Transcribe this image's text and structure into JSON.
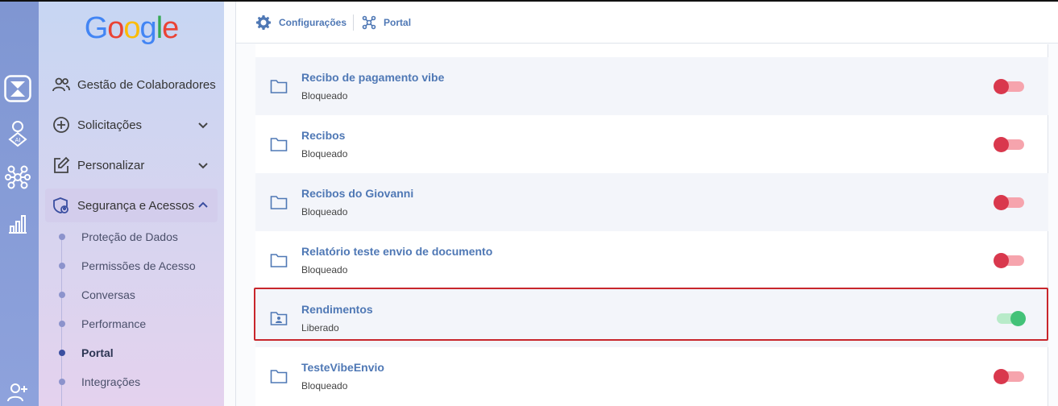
{
  "sidebar": {
    "logo_letters": [
      {
        "char": "G",
        "color": "#4285F4"
      },
      {
        "char": "o",
        "color": "#EA4335"
      },
      {
        "char": "o",
        "color": "#FBBC05"
      },
      {
        "char": "g",
        "color": "#4285F4"
      },
      {
        "char": "l",
        "color": "#34A853"
      },
      {
        "char": "e",
        "color": "#EA4335"
      }
    ],
    "menu": [
      {
        "label": "Gestão de Colaboradores",
        "icon": "people-icon"
      },
      {
        "label": "Solicitações",
        "icon": "plus-circle-icon",
        "chevron": "down"
      },
      {
        "label": "Personalizar",
        "icon": "edit-icon",
        "chevron": "down"
      },
      {
        "label": "Segurança e Acessos",
        "icon": "shield-user-icon",
        "chevron": "up",
        "active": true
      }
    ],
    "submenu": [
      {
        "label": "Proteção de Dados"
      },
      {
        "label": "Permissões de Acesso"
      },
      {
        "label": "Conversas"
      },
      {
        "label": "Performance"
      },
      {
        "label": "Portal",
        "current": true
      },
      {
        "label": "Integrações"
      }
    ]
  },
  "rail": {
    "icons": [
      "hourglass-app-icon",
      "ai-user-icon",
      "network-icon",
      "bar-chart-icon",
      "add-user-icon"
    ]
  },
  "header": {
    "breadcrumb": [
      {
        "label": "Configurações",
        "icon": "gear-icon"
      },
      {
        "label": "Portal",
        "icon": "nodes-icon"
      }
    ]
  },
  "folders": [
    {
      "title": "Recibo de pagamento vibe",
      "status": "Bloqueado",
      "enabled": false
    },
    {
      "title": "Recibos",
      "status": "Bloqueado",
      "enabled": false
    },
    {
      "title": "Recibos do Giovanni",
      "status": "Bloqueado",
      "enabled": false
    },
    {
      "title": "Relatório teste envio de documento",
      "status": "Bloqueado",
      "enabled": false
    },
    {
      "title": "Rendimentos",
      "status": "Liberado",
      "enabled": true
    },
    {
      "title": "TesteVibeEnvio",
      "status": "Bloqueado",
      "enabled": false
    }
  ],
  "colors": {
    "accent": "#4f78b5",
    "toggle_off": "#d9384d",
    "toggle_on": "#43c278",
    "highlight": "#c8262c"
  }
}
